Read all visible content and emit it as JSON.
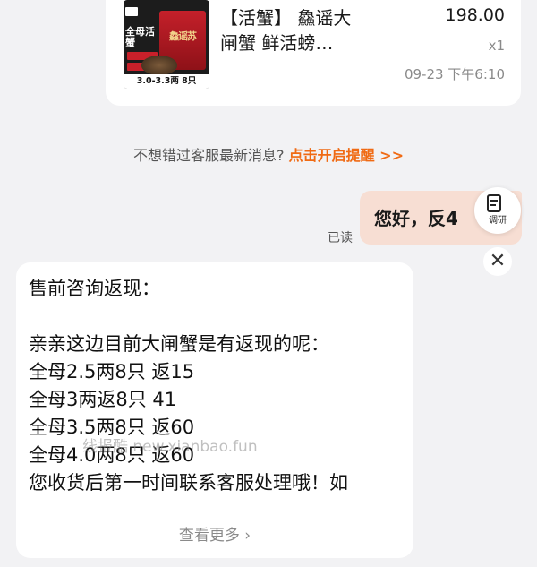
{
  "product": {
    "title_line1": "【活蟹】 鱻谣大",
    "title_line2": "闸蟹 鲜活螃…",
    "price": "198.00",
    "qty": "x1",
    "time": "09-23 下午6:10",
    "thumb_badge": "全母活蟹",
    "thumb_box_text": "鱻谣苏",
    "thumb_caption": "3.0-3.3两 8只"
  },
  "notice": {
    "text": "不想错过客服最新消息?",
    "link": "点击开启提醒 >>"
  },
  "outgoing": {
    "text": "您好，反4",
    "status": "已读"
  },
  "survey": {
    "label": "调研"
  },
  "close": {
    "glyph": "✕"
  },
  "incoming": {
    "lines": [
      "售前咨询返现：",
      "亲亲这边目前大闸蟹是有返现的呢：",
      "全母2.5两8只 返15",
      "全母3两返8只 41",
      "全母3.5两8只 返60",
      "全母4.0两8只 返60",
      "您收货后第一时间联系客服处理哦！如"
    ],
    "more": "查看更多 ›"
  },
  "watermark": "线报酷 new.xianbao.fun",
  "colors": {
    "accent_link": "#f06a13",
    "outgoing_bubble": "#f7ded3",
    "background": "#f2f2f4"
  }
}
